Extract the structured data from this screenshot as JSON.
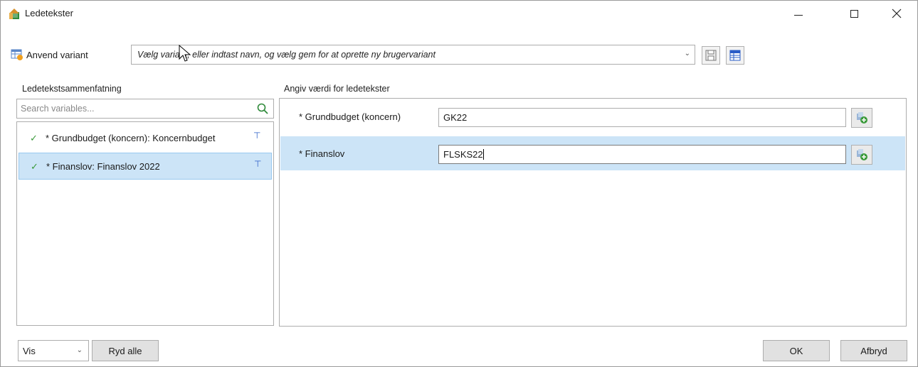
{
  "window": {
    "title": "Ledetekster",
    "icon": "prompt-app-icon",
    "controls": [
      "minimize-icon",
      "maximize-icon",
      "close-icon"
    ]
  },
  "variant": {
    "label": "Anvend variant",
    "placeholder": "Vælg variant, eller indtast navn, og vælg gem for at oprette ny brugervariant",
    "save_icon": "floppy-disk-icon",
    "manage_icon": "table-icon"
  },
  "left": {
    "title": "Ledetekstsammenfatning",
    "search_placeholder": "Search variables...",
    "items": [
      {
        "label": "* Grundbudget (koncern): Koncernbudget",
        "checked": true,
        "selected": false
      },
      {
        "label": "* Finanslov: Finanslov 2022",
        "checked": true,
        "selected": true
      }
    ]
  },
  "right": {
    "title": "Angiv værdi for ledetekster",
    "rows": [
      {
        "label": "* Grundbudget (koncern)",
        "value": "GK22",
        "highlighted": false
      },
      {
        "label": "* Finanslov",
        "value": "FLSKS22",
        "highlighted": true
      }
    ]
  },
  "bottom": {
    "vis_value": "Vis",
    "clear_label": "Ryd alle",
    "ok_label": "OK",
    "cancel_label": "Afbryd"
  },
  "colors": {
    "selection": "#cce4f7",
    "check": "#3a9a3a",
    "pin": "#2a5cc7"
  }
}
